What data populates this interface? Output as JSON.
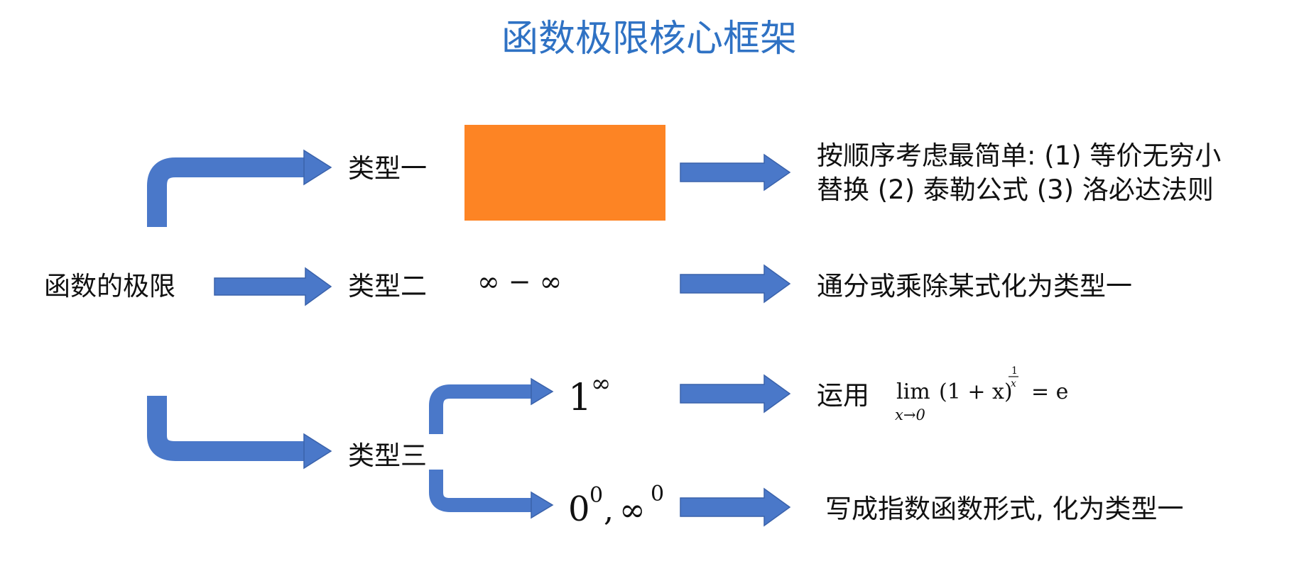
{
  "title": "函数极限核心框架",
  "root_label": "函数的极限",
  "types": [
    {
      "name": "类型一",
      "form": "",
      "form_block_color": "#fd8424",
      "method_lines": [
        "按顺序考虑最简单: (1) 等价无穷小",
        "替换 (2) 泰勒公式 (3) 洛必达法则"
      ]
    },
    {
      "name": "类型二",
      "form": "∞ − ∞",
      "method_lines": [
        "通分或乘除某式化为类型一"
      ]
    },
    {
      "name": "类型三",
      "subtypes": [
        {
          "form_base": "1",
          "form_exp": "∞",
          "method_prefix": "运用",
          "formula": {
            "lim": "lim",
            "sub": "x→0",
            "body": "(1 + x)",
            "exp_num": "1",
            "exp_den": "x",
            "rhs": "= e"
          }
        },
        {
          "form_part1_base": "0",
          "form_part1_exp": "0",
          "form_sep": ",",
          "form_part2_base": "∞",
          "form_part2_exp": "0",
          "method_lines": [
            "写成指数函数形式, 化为类型一"
          ]
        }
      ]
    }
  ],
  "colors": {
    "title": "#2f72c4",
    "arrow": "#4a78c9",
    "highlight_block": "#fd8424"
  },
  "icons": [
    "block-arrow-right",
    "bent-arrow"
  ]
}
